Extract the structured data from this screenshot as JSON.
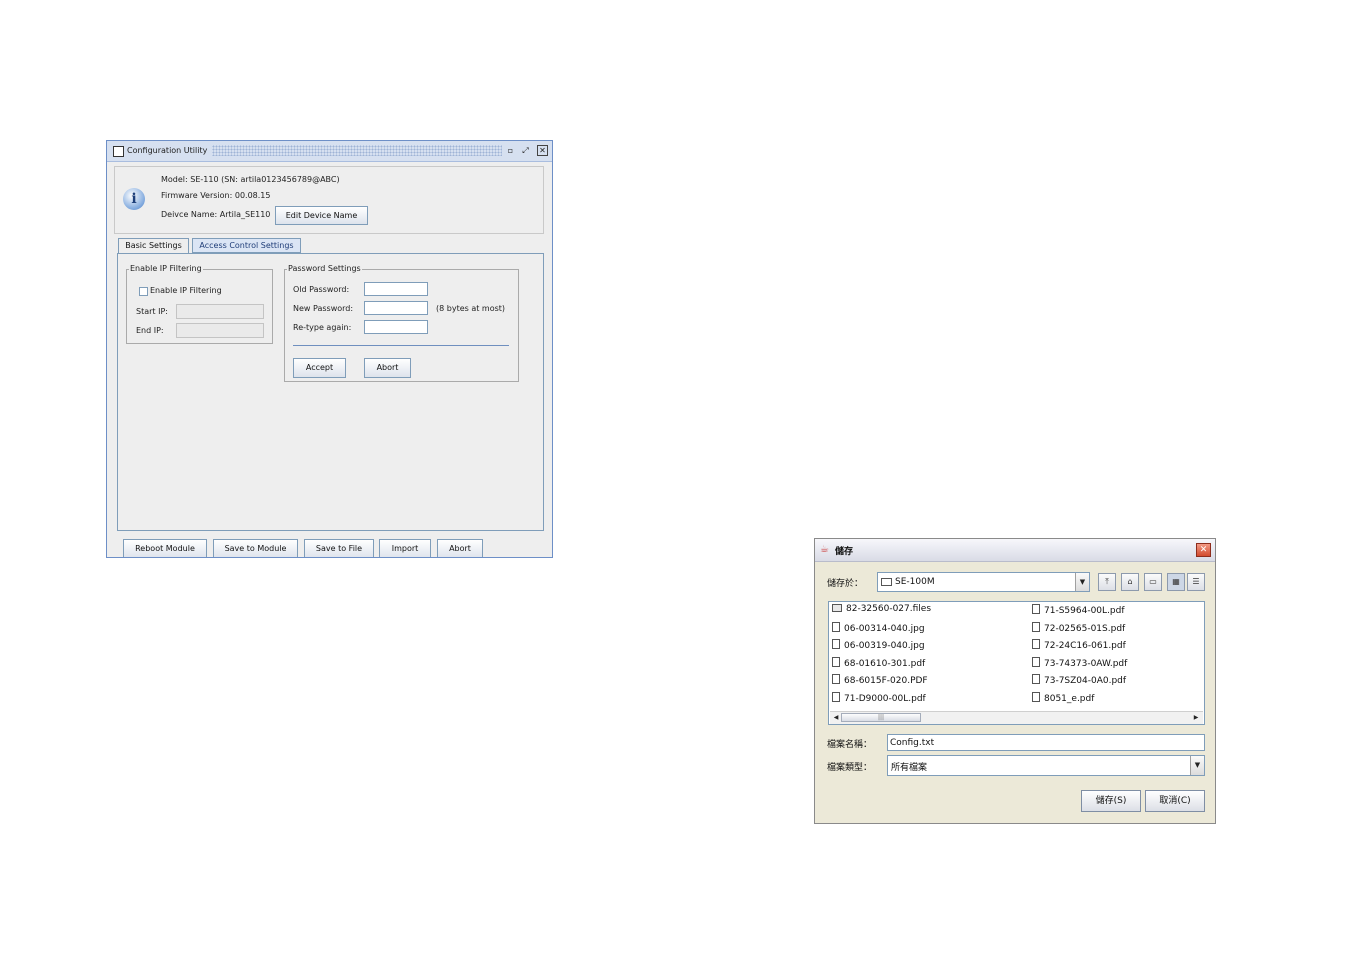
{
  "config_window": {
    "title": "Configuration Utility",
    "model_line": "Model: SE-110  (SN: artila0123456789@ABC)",
    "firmware_line": "Firmware Version: 00.08.15",
    "device_name_line": "Deivce Name: Artila_SE110",
    "info_icon_glyph": "i",
    "edit_device_name_label": "Edit Device Name",
    "tabs": [
      {
        "label": "Basic Settings",
        "active": true
      },
      {
        "label": "Access Control Settings",
        "active": false
      }
    ],
    "ip_filtering": {
      "legend": "Enable IP Filtering",
      "checkbox_label": "Enable IP Filtering",
      "start_ip_label": "Start IP:",
      "end_ip_label": "End IP:"
    },
    "password_settings": {
      "legend": "Password Settings",
      "old_password_label": "Old Password:",
      "new_password_label": "New Password:",
      "new_password_hint": "(8 bytes at most)",
      "retype_label": "Re-type again:",
      "accept_label": "Accept",
      "abort_label": "Abort"
    },
    "footer_buttons": {
      "reboot": "Reboot Module",
      "save_to_module": "Save to Module",
      "save_to_file": "Save to File",
      "import": "Import",
      "abort": "Abort"
    }
  },
  "save_dialog": {
    "title": "儲存",
    "save_in_label": "儲存於：",
    "save_in_value": "SE-100M",
    "files_left": [
      {
        "name": "82-32560-027.files",
        "icon": "folder-icon"
      },
      {
        "name": "06-00314-040.jpg",
        "icon": "file-icon"
      },
      {
        "name": "06-00319-040.jpg",
        "icon": "file-icon"
      },
      {
        "name": "68-01610-301.pdf",
        "icon": "file-icon"
      },
      {
        "name": "68-6015F-020.PDF",
        "icon": "file-icon"
      },
      {
        "name": "71-D9000-00L.pdf",
        "icon": "file-icon"
      }
    ],
    "files_right": [
      {
        "name": "71-S5964-00L.pdf",
        "icon": "file-icon"
      },
      {
        "name": "72-02565-01S.pdf",
        "icon": "file-icon"
      },
      {
        "name": "72-24C16-061.pdf",
        "icon": "file-icon"
      },
      {
        "name": "73-74373-0AW.pdf",
        "icon": "file-icon"
      },
      {
        "name": "73-7SZ04-0A0.pdf",
        "icon": "file-icon"
      },
      {
        "name": "8051_e.pdf",
        "icon": "file-icon"
      }
    ],
    "file_name_label": "檔案名稱：",
    "file_name_value": "Config.txt",
    "file_type_label": "檔案類型：",
    "file_type_value": "所有檔案",
    "save_button_label": "儲存(S)",
    "cancel_button_label": "取消(C)"
  }
}
